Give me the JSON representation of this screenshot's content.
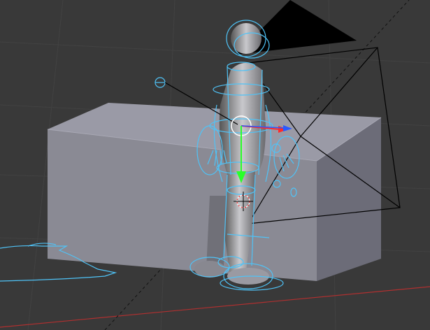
{
  "viewport": {
    "background": "#393939",
    "grid_color": "#464646",
    "wire_color": "#4fc3f7",
    "camera_color": "#000000",
    "box_color": "#86868f",
    "x_axis_color": "#b03030"
  },
  "objects": {
    "box": "box-mesh",
    "character": "character-mesh",
    "armature": "armature-wire-rig",
    "camera": "camera-object",
    "camera_triangle": "camera-up-triangle",
    "gizmo": "transform-gizmo",
    "cursor": "3d-cursor"
  }
}
